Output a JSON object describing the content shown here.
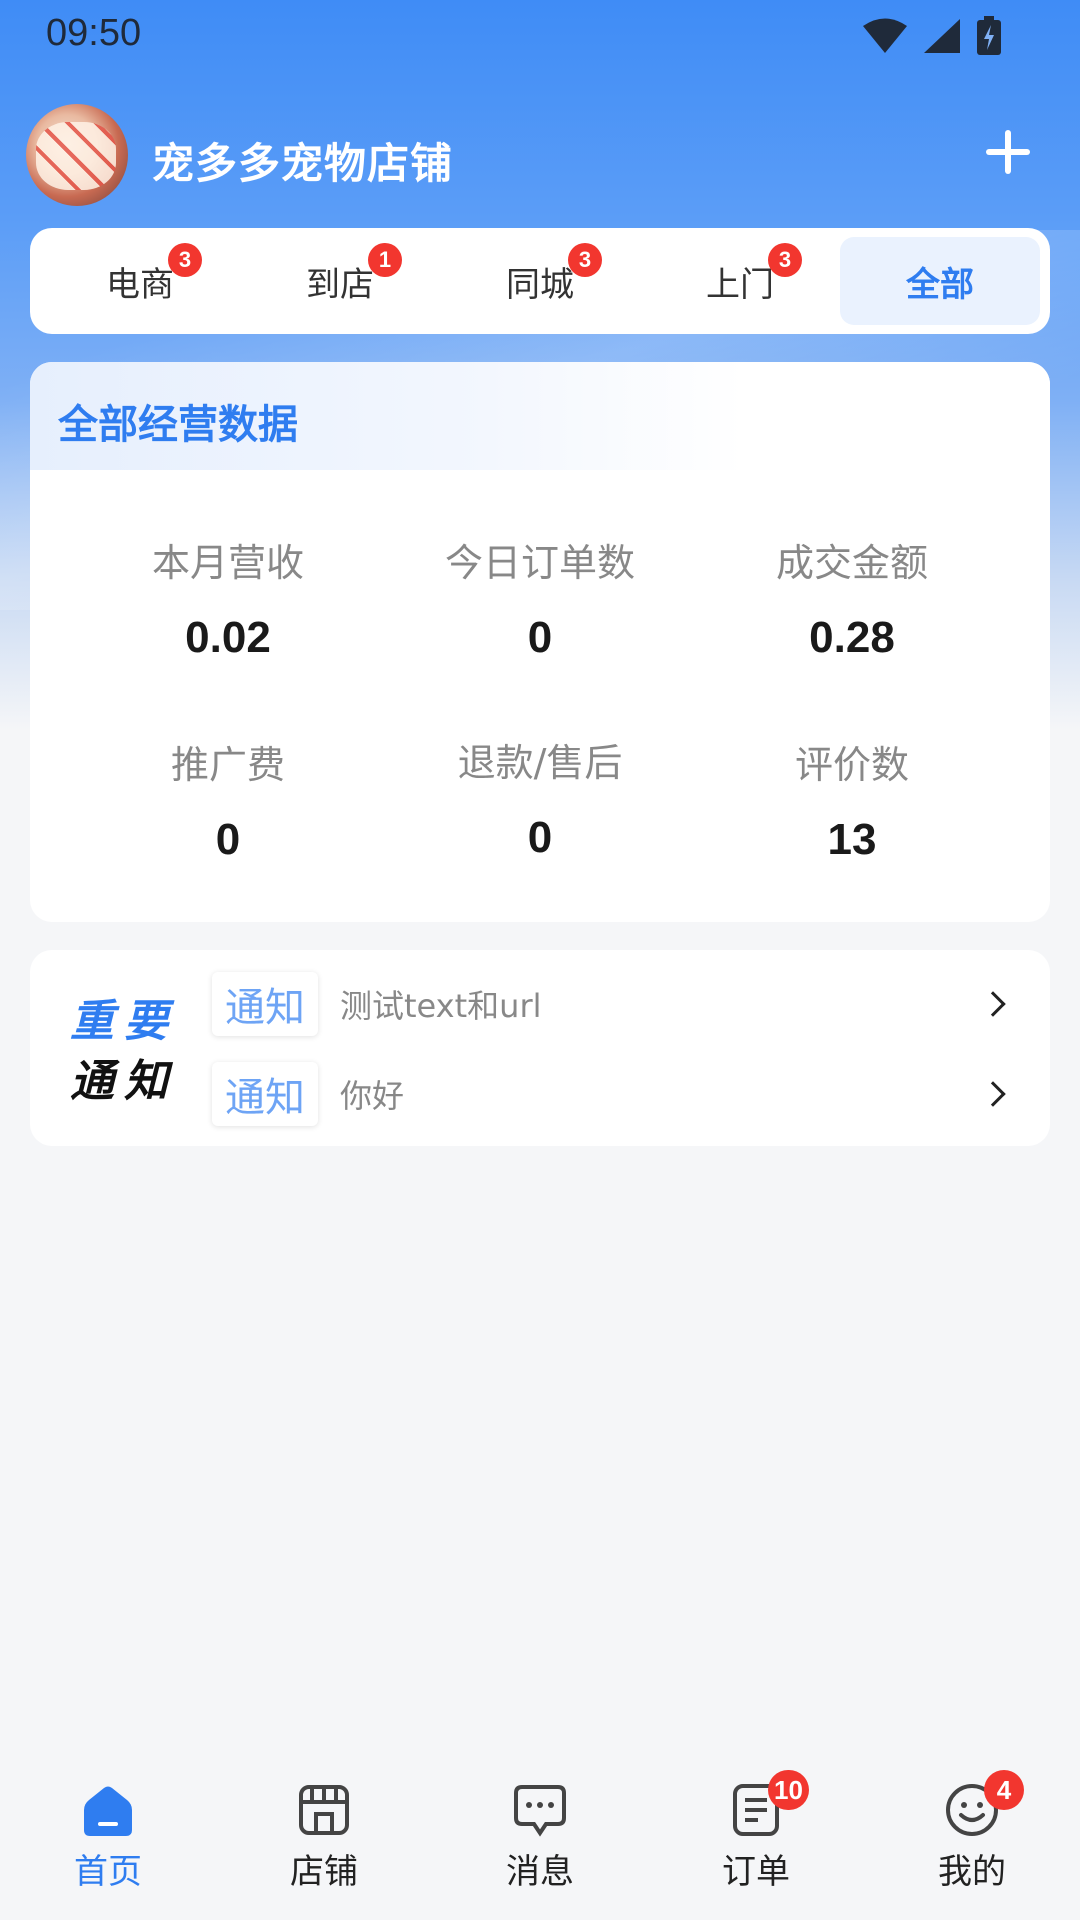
{
  "status_bar": {
    "time": "09:50",
    "icons": [
      "wifi-icon",
      "signal-icon",
      "battery-charging-icon"
    ]
  },
  "header": {
    "shop_name": "宠多多宠物店铺",
    "avatar": "avatar",
    "add_icon": "plus-icon"
  },
  "tabs": [
    {
      "label": "电商",
      "badge": "3",
      "active": false
    },
    {
      "label": "到店",
      "badge": "1",
      "active": false
    },
    {
      "label": "同城",
      "badge": "3",
      "active": false
    },
    {
      "label": "上门",
      "badge": "3",
      "active": false
    },
    {
      "label": "全部",
      "badge": "",
      "active": true
    }
  ],
  "stats": {
    "title": "全部经营数据",
    "items": [
      {
        "label": "本月营收",
        "value": "0.02"
      },
      {
        "label": "今日订单数",
        "value": "0"
      },
      {
        "label": "成交金额",
        "value": "0.28"
      },
      {
        "label": "推广费",
        "value": "0"
      },
      {
        "label": "退款/售后",
        "value": "0"
      },
      {
        "label": "评价数",
        "value": "13"
      }
    ]
  },
  "notices": {
    "logo_line1": "重要",
    "logo_line2": "通知",
    "items": [
      {
        "tag": "通知",
        "text": "测试text和url"
      },
      {
        "tag": "通知",
        "text": "你好"
      }
    ]
  },
  "bottom_nav": [
    {
      "label": "首页",
      "icon": "home-icon",
      "badge": "",
      "active": true
    },
    {
      "label": "店铺",
      "icon": "store-icon",
      "badge": "",
      "active": false
    },
    {
      "label": "消息",
      "icon": "message-icon",
      "badge": "",
      "active": false
    },
    {
      "label": "订单",
      "icon": "order-icon",
      "badge": "10",
      "active": false
    },
    {
      "label": "我的",
      "icon": "smile-icon",
      "badge": "4",
      "active": false
    }
  ],
  "colors": {
    "primary": "#2f7df0",
    "badge": "#f2362f",
    "header_bg": "#3f8cf6"
  }
}
